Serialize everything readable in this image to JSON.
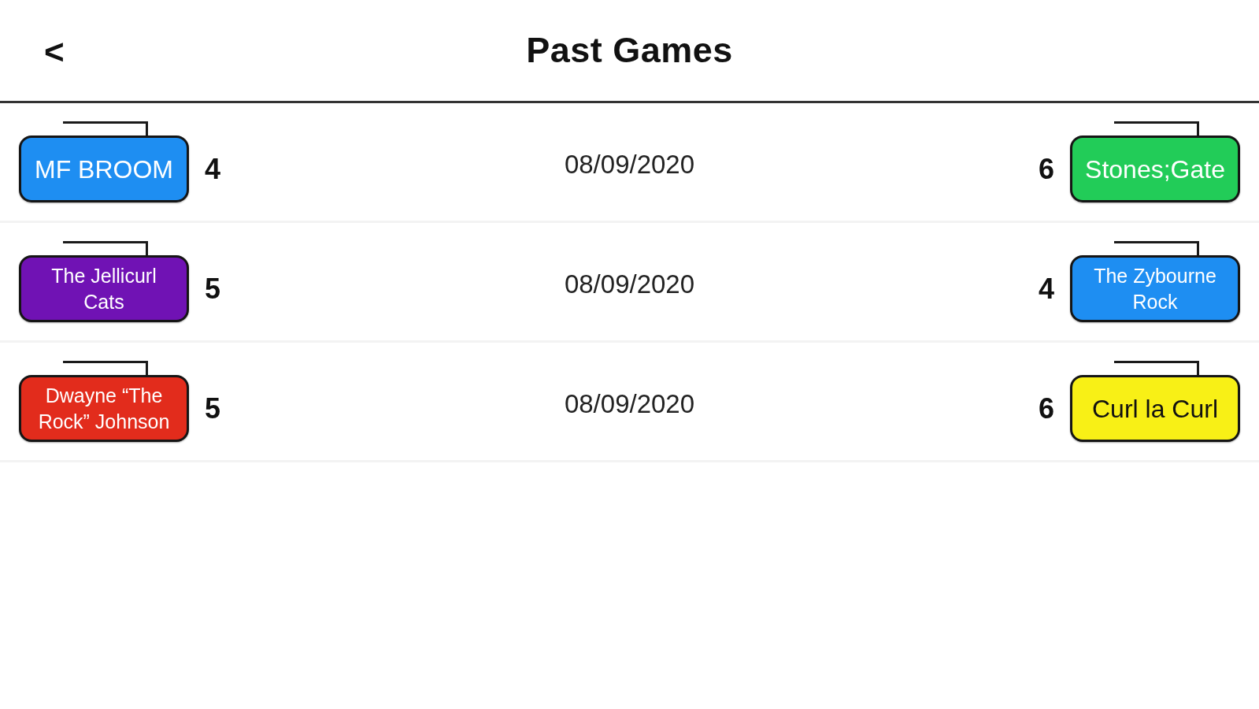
{
  "header": {
    "back": "<",
    "title": "Past Games"
  },
  "games": [
    {
      "home": {
        "name": "MF BROOM",
        "color": "#1e8ef2"
      },
      "home_score": "4",
      "date": "08/09/2020",
      "away_score": "6",
      "away": {
        "name": "Stones;Gate",
        "color": "#22cc58"
      }
    },
    {
      "home": {
        "name": "The Jellicurl Cats",
        "color": "#7012b4"
      },
      "home_score": "5",
      "date": "08/09/2020",
      "away_score": "4",
      "away": {
        "name": "The Zybourne Rock",
        "color": "#1e8ef2"
      }
    },
    {
      "home": {
        "name": "Dwayne “The Rock” Johnson",
        "color": "#e22c1c"
      },
      "home_score": "5",
      "date": "08/09/2020",
      "away_score": "6",
      "away": {
        "name": "Curl la Curl",
        "color": "#f8f016"
      }
    }
  ]
}
